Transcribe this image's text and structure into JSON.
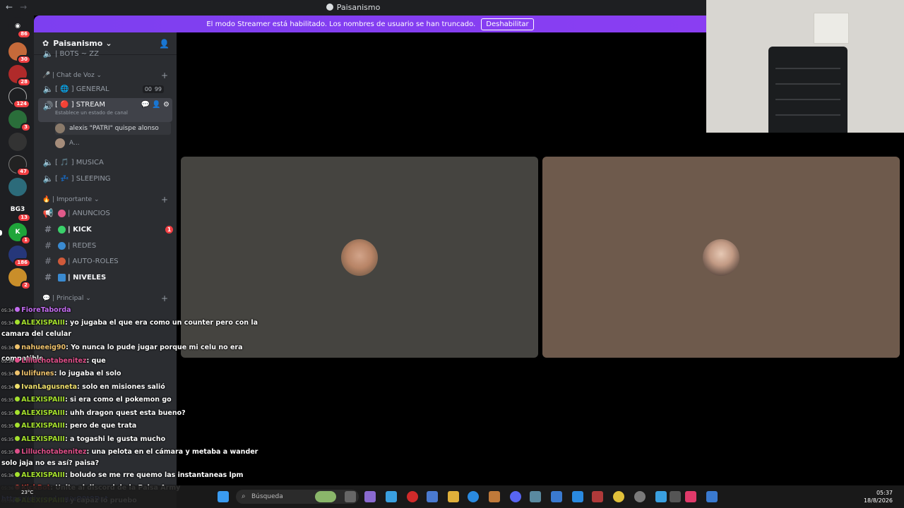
{
  "window": {
    "title": "Paisanismo"
  },
  "banner": {
    "text": "El modo Streamer está habilitado. Los nombres de usuario se han truncado.",
    "button": "Deshabilitar"
  },
  "rail": {
    "badges": [
      "86",
      "30",
      "28",
      "124",
      "3",
      "47",
      "13",
      "1",
      "186",
      "2"
    ],
    "bg3_label": "BG3"
  },
  "server": {
    "name": "Paisanismo"
  },
  "sidebar": {
    "truncated_top": "| BOTS ~ ZZ",
    "cat_voice": "| Chat de Voz",
    "voice_channels": [
      {
        "name": "[ 🌐 ] GENERAL",
        "count_a": "00",
        "count_b": "99"
      },
      {
        "name": "[ 🔴 ] STREAM",
        "status": "Establece un estado de canal"
      },
      {
        "name": "[ 🎵 ] MUSICA"
      },
      {
        "name": "[ 💤 ] SLEEPING"
      }
    ],
    "voice_users": [
      "alexis \"PATRI\" quispe alonso",
      "A..."
    ],
    "cat_important": "| Importante",
    "text_channels": [
      {
        "name": "| ANUNCIOS"
      },
      {
        "name": "| KICK",
        "badge": "1"
      },
      {
        "name": "| REDES"
      },
      {
        "name": "| AUTO-ROLES"
      },
      {
        "name": "| NIVELES"
      }
    ],
    "cat_main": "| Principal"
  },
  "chat": [
    {
      "ts": "05:34",
      "user": "FioreTaborda",
      "text": "",
      "color": "#c36cf0"
    },
    {
      "ts": "05:34",
      "user": "ALEXISPAIII",
      "text": ": yo jugaba el que era como un counter pero con la camara del celular",
      "color": "#a6e22e"
    },
    {
      "ts": "05:34",
      "user": "nahueeig90",
      "text": ": Yo nunca lo pude jugar porque mi celu no era compatible",
      "color": "#f0c36c"
    },
    {
      "ts": "05:34",
      "user": "Lilluchotabenitez",
      "text": ": que",
      "color": "#e0508a"
    },
    {
      "ts": "05:34",
      "user": "lulifunes",
      "text": ": lo jugaba el solo",
      "color": "#f0c36c"
    },
    {
      "ts": "05:34",
      "user": "IvanLagusneta",
      "text": ": solo en misiones salió",
      "color": "#f0e06c"
    },
    {
      "ts": "05:35",
      "user": "ALEXISPAIII",
      "text": ": si era como el pokemon go",
      "color": "#a6e22e"
    },
    {
      "ts": "05:35",
      "user": "ALEXISPAIII",
      "text": ": uhh dragon quest esta bueno?",
      "color": "#a6e22e"
    },
    {
      "ts": "05:35",
      "user": "ALEXISPAIII",
      "text": ": pero de que trata",
      "color": "#a6e22e"
    },
    {
      "ts": "05:35",
      "user": "ALEXISPAIII",
      "text": ": a togashi le gusta mucho",
      "color": "#a6e22e"
    },
    {
      "ts": "05:35",
      "user": "Lilluchotabenitez",
      "text": ": una pelota en el cámara y metaba a wander solo jaja no es así? paisa?",
      "color": "#e0508a"
    },
    {
      "ts": "05:36",
      "user": "ALEXISPAIII",
      "text": ": boludo se me rre quemo las instantaneas lpm",
      "color": "#a6e22e"
    },
    {
      "ts": "05:36",
      "user": "KickBot",
      "text": ": Unite al discord de la Paisa Army ",
      "link": "https://discord.gg/uQ9t9Dnt",
      "color": "#e8463c"
    },
    {
      "ts": "05:36",
      "user": "ALEXISPAIII",
      "text": ": y capaz lo pruebo",
      "color": "#a6e22e"
    }
  ],
  "taskbar": {
    "weather": "23°C",
    "search_placeholder": "Búsqueda",
    "time": "05:37",
    "date": "18/8/2026"
  },
  "colors": {
    "accent": "#5865f2",
    "banner": "#8a3ef2",
    "tile_left": "#454440",
    "tile_right": "#6e5a4c"
  }
}
